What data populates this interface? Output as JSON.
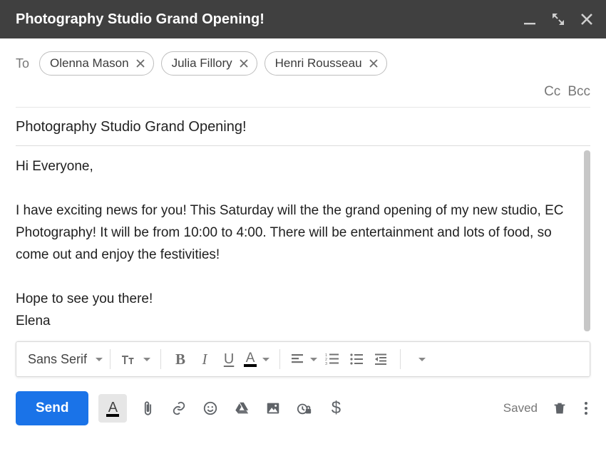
{
  "header": {
    "title": "Photography Studio Grand Opening!"
  },
  "to": {
    "label": "To",
    "recipients": [
      "Olenna Mason",
      "Julia Fillory",
      "Henri Rousseau"
    ],
    "cc_label": "Cc",
    "bcc_label": "Bcc"
  },
  "subject": "Photography Studio Grand Opening!",
  "body": "Hi Everyone,\n\nI have exciting news for you! This Saturday will the the grand opening of my new studio, EC Photography! It will be from 10:00 to 4:00. There will be entertainment and lots of food, so come out and enjoy the festivities!\n\nHope to see you there!\nElena",
  "format_bar": {
    "font_name": "Sans Serif"
  },
  "bottom": {
    "send_label": "Send",
    "saved_label": "Saved"
  }
}
